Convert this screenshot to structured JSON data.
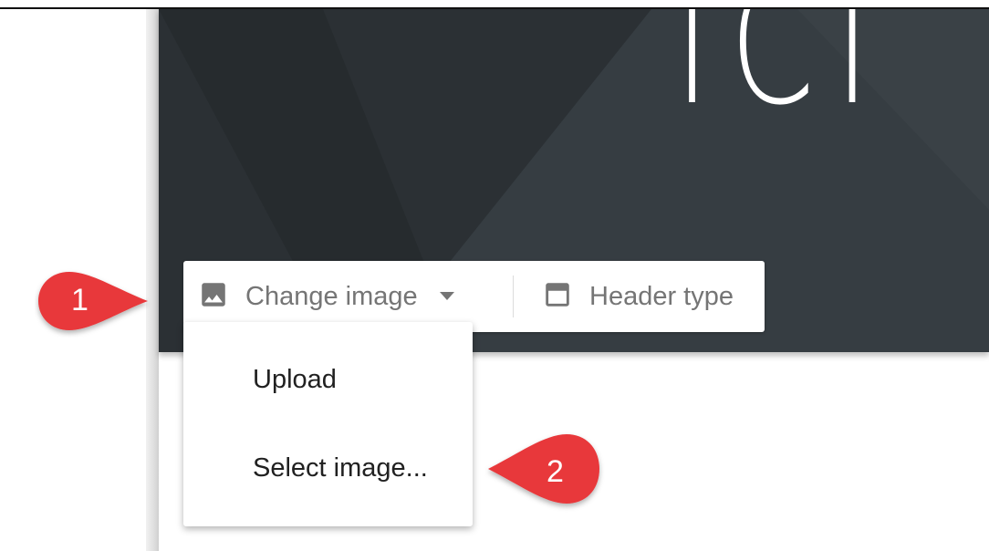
{
  "header": {
    "title_text": "ICI"
  },
  "toolbar": {
    "change_image": {
      "label": "Change image",
      "icon": "image-icon",
      "caret_icon": "caret-down-icon"
    },
    "header_type": {
      "label": "Header type",
      "icon": "header-layout-icon"
    }
  },
  "menu": {
    "items": [
      {
        "label": "Upload"
      },
      {
        "label": "Select image..."
      }
    ]
  },
  "callouts": [
    {
      "number": "1",
      "color": "#e8383b"
    },
    {
      "number": "2",
      "color": "#e8383b"
    }
  ],
  "colors": {
    "banner": "#2f3539",
    "toolbar_text": "#757575",
    "menu_text": "#212121"
  }
}
